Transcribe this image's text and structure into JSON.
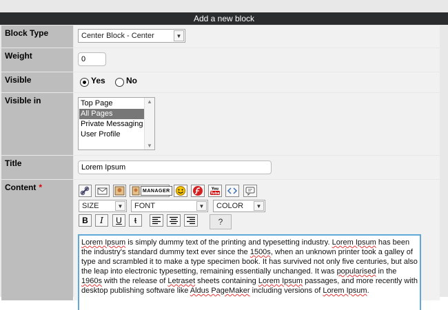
{
  "form": {
    "title": "Add a new block",
    "block_type": {
      "label": "Block Type",
      "value": "Center Block - Center"
    },
    "weight": {
      "label": "Weight",
      "value": "0"
    },
    "visible": {
      "label": "Visible",
      "yes_label": "Yes",
      "no_label": "No",
      "selected": "Yes"
    },
    "visible_in": {
      "label": "Visible in",
      "options": [
        "Top Page",
        "All Pages",
        "Private Messaging",
        "User Profile"
      ],
      "selected": "All Pages"
    },
    "title_field": {
      "label": "Title",
      "value": "Lorem Ipsum"
    },
    "content": {
      "label": "Content",
      "required_mark": "*"
    }
  },
  "toolbar": {
    "manager_label": "MANAGER",
    "youtube_label": "You Tube",
    "size_select": "SIZE",
    "font_select": "FONT",
    "color_select": "COLOR",
    "bold_label": "B",
    "italic_label": "I",
    "underline_label": "U",
    "strike_label": "t",
    "help_label": "?"
  },
  "editor": {
    "segments": [
      [
        "Lorem Ipsum",
        true
      ],
      [
        " is simply dummy text of the printing and typesetting industry. ",
        false
      ],
      [
        "Lorem Ipsum",
        true
      ],
      [
        " has been the industry's standard dummy text ever since the ",
        false
      ],
      [
        "1500s",
        true
      ],
      [
        ", when an unknown printer took a galley of type and scrambled it to make a type specimen book. It has survived not only five centuries, but also the leap into electronic typesetting, remaining essentially unchanged. It was ",
        false
      ],
      [
        "popularised",
        true
      ],
      [
        " in the ",
        false
      ],
      [
        "1960s",
        true
      ],
      [
        " with the release of ",
        false
      ],
      [
        "Letraset",
        true
      ],
      [
        " sheets containing ",
        false
      ],
      [
        "Lorem Ipsum",
        true
      ],
      [
        " passages, and more recently with desktop publishing software like ",
        false
      ],
      [
        "Aldus PageMaker",
        true
      ],
      [
        " including versions of ",
        false
      ],
      [
        "Lorem Ipsum",
        true
      ],
      [
        ".",
        false
      ]
    ]
  },
  "colors": {
    "header_bg": "#2a2c2e",
    "label_bg": "#bdbdbd",
    "editor_border": "#5fa9d8"
  }
}
